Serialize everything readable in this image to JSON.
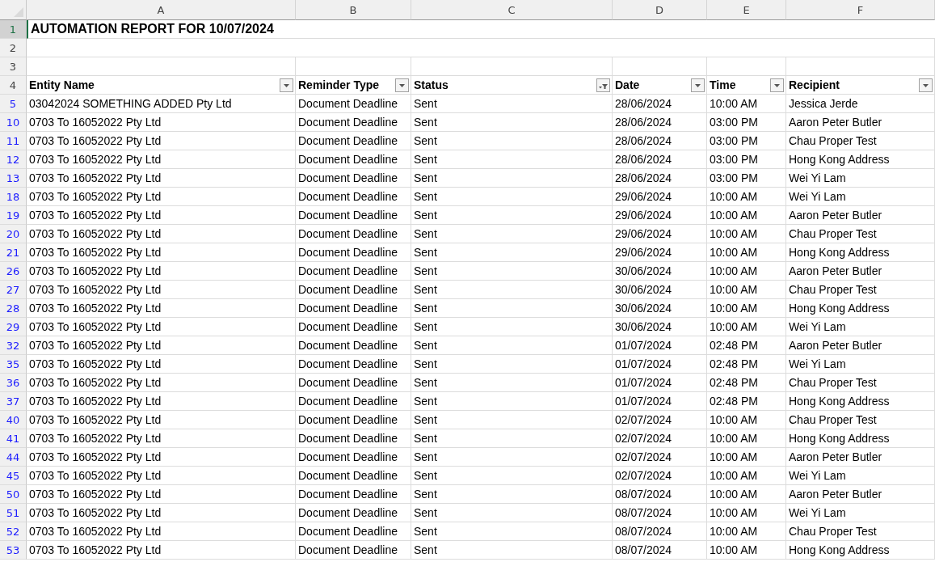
{
  "column_letters": [
    "A",
    "B",
    "C",
    "D",
    "E",
    "F"
  ],
  "title_row": {
    "number": "1",
    "selected": true,
    "text": "AUTOMATION REPORT FOR 10/07/2024"
  },
  "blank_rows": [
    {
      "number": "2"
    },
    {
      "number": "3"
    }
  ],
  "header_row": {
    "number": "4",
    "columns": [
      {
        "label": "Entity Name",
        "filtered": false
      },
      {
        "label": "Reminder Type",
        "filtered": false
      },
      {
        "label": "Status",
        "filtered": true
      },
      {
        "label": "Date",
        "filtered": false
      },
      {
        "label": "Time",
        "filtered": false
      },
      {
        "label": "Recipient",
        "filtered": false
      }
    ]
  },
  "rows": [
    {
      "number": "5",
      "filtered": true,
      "cells": [
        "03042024 SOMETHING ADDED Pty Ltd",
        "Document Deadline",
        "Sent",
        "28/06/2024",
        "10:00 AM",
        "Jessica Jerde"
      ]
    },
    {
      "number": "10",
      "filtered": true,
      "cells": [
        "0703 To 16052022 Pty Ltd",
        "Document Deadline",
        "Sent",
        "28/06/2024",
        "03:00 PM",
        "Aaron Peter Butler"
      ]
    },
    {
      "number": "11",
      "filtered": true,
      "cells": [
        "0703 To 16052022 Pty Ltd",
        "Document Deadline",
        "Sent",
        "28/06/2024",
        "03:00 PM",
        "Chau Proper Test"
      ]
    },
    {
      "number": "12",
      "filtered": true,
      "cells": [
        "0703 To 16052022 Pty Ltd",
        "Document Deadline",
        "Sent",
        "28/06/2024",
        "03:00 PM",
        "Hong Kong Address"
      ]
    },
    {
      "number": "13",
      "filtered": true,
      "cells": [
        "0703 To 16052022 Pty Ltd",
        "Document Deadline",
        "Sent",
        "28/06/2024",
        "03:00 PM",
        "Wei Yi Lam"
      ]
    },
    {
      "number": "18",
      "filtered": true,
      "cells": [
        "0703 To 16052022 Pty Ltd",
        "Document Deadline",
        "Sent",
        "29/06/2024",
        "10:00 AM",
        "Wei Yi Lam"
      ]
    },
    {
      "number": "19",
      "filtered": true,
      "cells": [
        "0703 To 16052022 Pty Ltd",
        "Document Deadline",
        "Sent",
        "29/06/2024",
        "10:00 AM",
        "Aaron Peter Butler"
      ]
    },
    {
      "number": "20",
      "filtered": true,
      "cells": [
        "0703 To 16052022 Pty Ltd",
        "Document Deadline",
        "Sent",
        "29/06/2024",
        "10:00 AM",
        "Chau Proper Test"
      ]
    },
    {
      "number": "21",
      "filtered": true,
      "cells": [
        "0703 To 16052022 Pty Ltd",
        "Document Deadline",
        "Sent",
        "29/06/2024",
        "10:00 AM",
        "Hong Kong Address"
      ]
    },
    {
      "number": "26",
      "filtered": true,
      "cells": [
        "0703 To 16052022 Pty Ltd",
        "Document Deadline",
        "Sent",
        "30/06/2024",
        "10:00 AM",
        "Aaron Peter Butler"
      ]
    },
    {
      "number": "27",
      "filtered": true,
      "cells": [
        "0703 To 16052022 Pty Ltd",
        "Document Deadline",
        "Sent",
        "30/06/2024",
        "10:00 AM",
        "Chau Proper Test"
      ]
    },
    {
      "number": "28",
      "filtered": true,
      "cells": [
        "0703 To 16052022 Pty Ltd",
        "Document Deadline",
        "Sent",
        "30/06/2024",
        "10:00 AM",
        "Hong Kong Address"
      ]
    },
    {
      "number": "29",
      "filtered": true,
      "cells": [
        "0703 To 16052022 Pty Ltd",
        "Document Deadline",
        "Sent",
        "30/06/2024",
        "10:00 AM",
        "Wei Yi Lam"
      ]
    },
    {
      "number": "32",
      "filtered": true,
      "cells": [
        "0703 To 16052022 Pty Ltd",
        "Document Deadline",
        "Sent",
        "01/07/2024",
        "02:48 PM",
        "Aaron Peter Butler"
      ]
    },
    {
      "number": "35",
      "filtered": true,
      "cells": [
        "0703 To 16052022 Pty Ltd",
        "Document Deadline",
        "Sent",
        "01/07/2024",
        "02:48 PM",
        "Wei Yi Lam"
      ]
    },
    {
      "number": "36",
      "filtered": true,
      "cells": [
        "0703 To 16052022 Pty Ltd",
        "Document Deadline",
        "Sent",
        "01/07/2024",
        "02:48 PM",
        "Chau Proper Test"
      ]
    },
    {
      "number": "37",
      "filtered": true,
      "cells": [
        "0703 To 16052022 Pty Ltd",
        "Document Deadline",
        "Sent",
        "01/07/2024",
        "02:48 PM",
        "Hong Kong Address"
      ]
    },
    {
      "number": "40",
      "filtered": true,
      "cells": [
        "0703 To 16052022 Pty Ltd",
        "Document Deadline",
        "Sent",
        "02/07/2024",
        "10:00 AM",
        "Chau Proper Test"
      ]
    },
    {
      "number": "41",
      "filtered": true,
      "cells": [
        "0703 To 16052022 Pty Ltd",
        "Document Deadline",
        "Sent",
        "02/07/2024",
        "10:00 AM",
        "Hong Kong Address"
      ]
    },
    {
      "number": "44",
      "filtered": true,
      "cells": [
        "0703 To 16052022 Pty Ltd",
        "Document Deadline",
        "Sent",
        "02/07/2024",
        "10:00 AM",
        "Aaron Peter Butler"
      ]
    },
    {
      "number": "45",
      "filtered": true,
      "cells": [
        "0703 To 16052022 Pty Ltd",
        "Document Deadline",
        "Sent",
        "02/07/2024",
        "10:00 AM",
        "Wei Yi Lam"
      ]
    },
    {
      "number": "50",
      "filtered": true,
      "cells": [
        "0703 To 16052022 Pty Ltd",
        "Document Deadline",
        "Sent",
        "08/07/2024",
        "10:00 AM",
        "Aaron Peter Butler"
      ]
    },
    {
      "number": "51",
      "filtered": true,
      "cells": [
        "0703 To 16052022 Pty Ltd",
        "Document Deadline",
        "Sent",
        "08/07/2024",
        "10:00 AM",
        "Wei Yi Lam"
      ]
    },
    {
      "number": "52",
      "filtered": true,
      "cells": [
        "0703 To 16052022 Pty Ltd",
        "Document Deadline",
        "Sent",
        "08/07/2024",
        "10:00 AM",
        "Chau Proper Test"
      ]
    },
    {
      "number": "53",
      "filtered": true,
      "cells": [
        "0703 To 16052022 Pty Ltd",
        "Document Deadline",
        "Sent",
        "08/07/2024",
        "10:00 AM",
        "Hong Kong Address"
      ]
    }
  ]
}
